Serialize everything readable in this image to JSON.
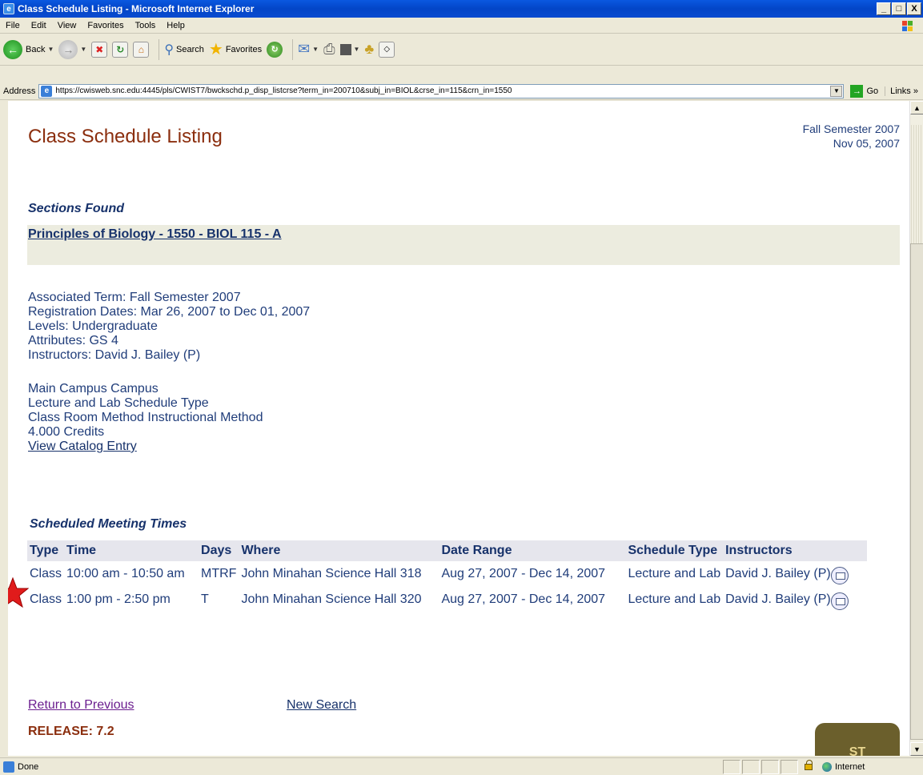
{
  "window": {
    "title": "Class Schedule Listing - Microsoft Internet Explorer",
    "buttons": [
      "_",
      "□",
      "X"
    ]
  },
  "menu": [
    "File",
    "Edit",
    "View",
    "Favorites",
    "Tools",
    "Help"
  ],
  "toolbar": {
    "back_label": "Back",
    "search_label": "Search",
    "favorites_label": "Favorites"
  },
  "address": {
    "label": "Address",
    "url": "https://cwisweb.snc.edu:4445/pls/CWIST7/bwckschd.p_disp_listcrse?term_in=200710&subj_in=BIOL&crse_in=115&crn_in=1550",
    "go_label": "Go",
    "links_label": "Links"
  },
  "page": {
    "title": "Class Schedule Listing",
    "term": "Fall Semester 2007",
    "date": "Nov 05, 2007",
    "sections_heading": "Sections Found",
    "section_link": "Principles of Biology - 1550 - BIOL 115 - A",
    "details": [
      "Associated Term: Fall Semester 2007",
      "Registration Dates: Mar 26, 2007 to Dec 01, 2007",
      "Levels: Undergraduate",
      "Attributes: GS 4",
      "Instructors: David J. Bailey (P)"
    ],
    "details2": [
      "Main Campus Campus",
      "Lecture and Lab Schedule Type",
      "Class Room Method Instructional Method",
      "4.000 Credits"
    ],
    "catalog_link": "View Catalog Entry",
    "meeting_caption": "Scheduled Meeting Times",
    "meeting_headers": [
      "Type",
      "Time",
      "Days",
      "Where",
      "Date Range",
      "Schedule Type",
      "Instructors"
    ],
    "meetings": [
      [
        "Class",
        "10:00 am - 10:50 am",
        "MTRF",
        "John Minahan Science Hall 318",
        "Aug 27, 2007 - Dec 14, 2007",
        "Lecture and Lab",
        "David J. Bailey (P)"
      ],
      [
        "Class",
        "1:00 pm - 2:50 pm",
        "T",
        "John Minahan Science Hall 320",
        "Aug 27, 2007 - Dec 14, 2007",
        "Lecture and Lab",
        "David J. Bailey (P)"
      ]
    ],
    "return_link": "Return to Previous",
    "new_search_link": "New Search",
    "release": "RELEASE: 7.2",
    "seal_text": "ST"
  },
  "status": {
    "text": "Done",
    "zone": "Internet"
  },
  "colors": {
    "title_brown": "#8b2e0e",
    "link_navy": "#17326b",
    "text_blue": "#203d7a",
    "visited_purple": "#6b1e8f"
  }
}
